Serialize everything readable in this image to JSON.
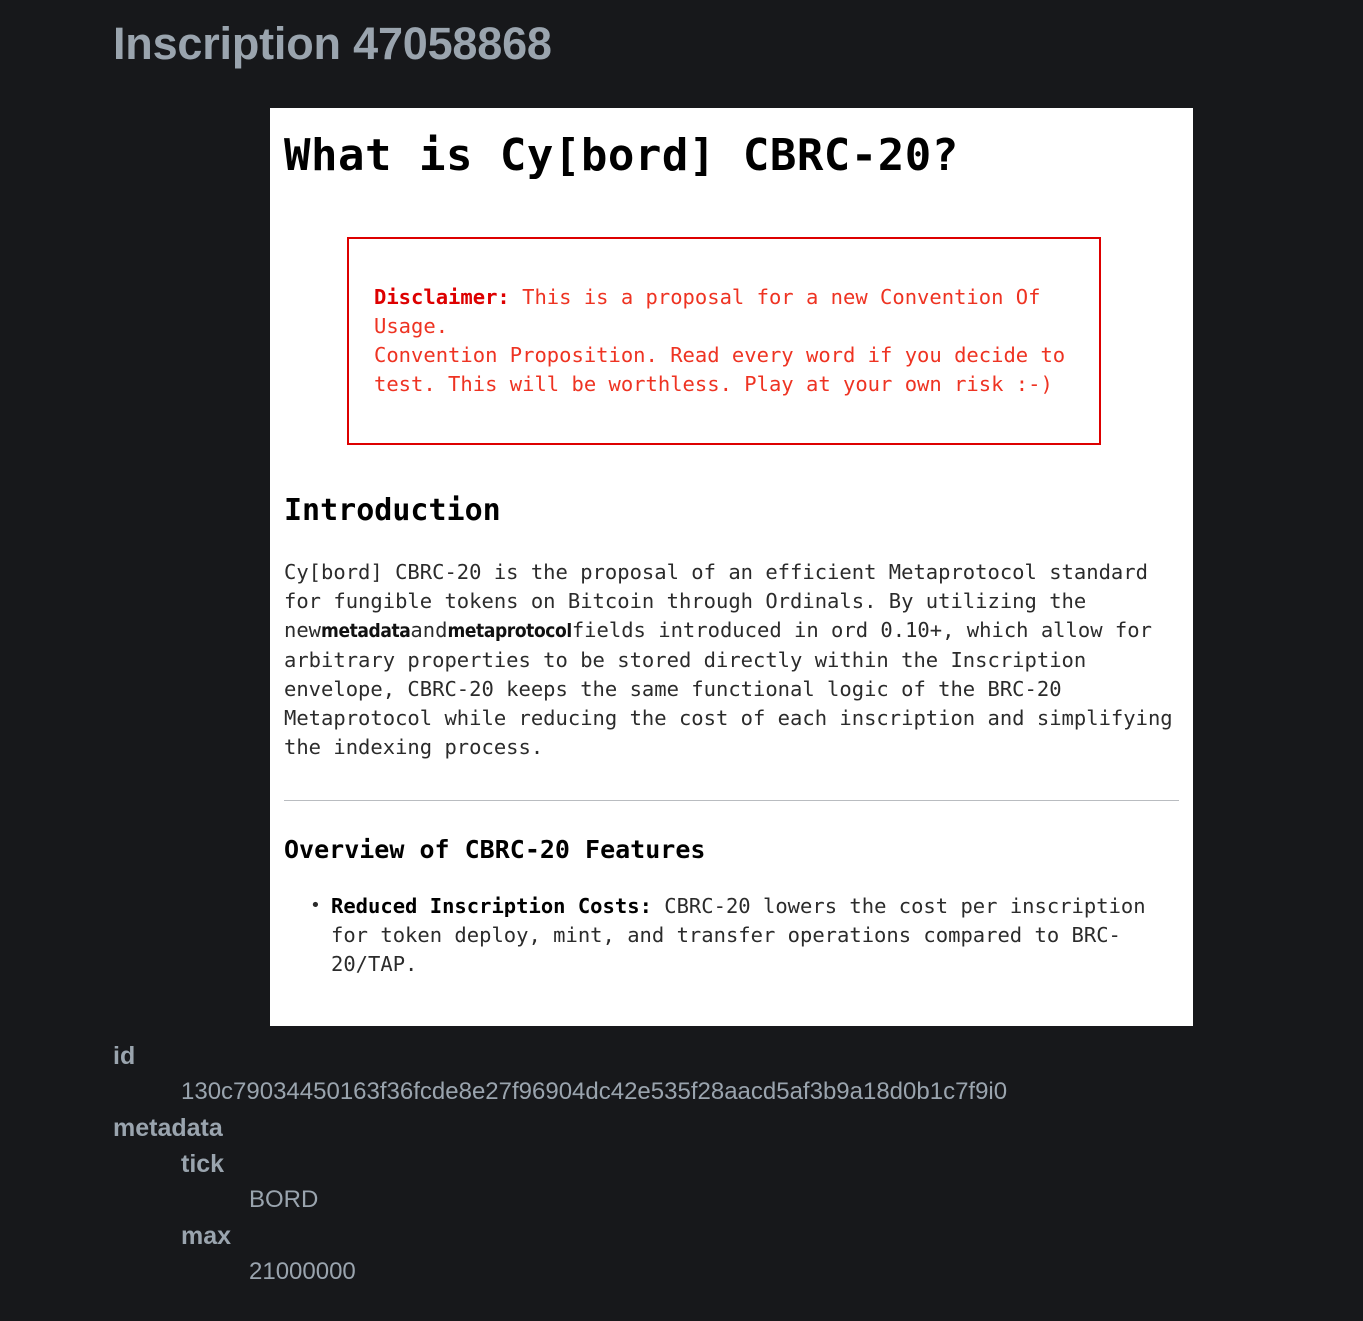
{
  "page": {
    "title": "Inscription 47058868",
    "background_color": "#17181b",
    "text_color": "#9aa4ae"
  },
  "preview": {
    "heading": "What is Cy[bord] CBRC-20?",
    "disclaimer": {
      "label": "Disclaimer",
      "separator": ": ",
      "border_color": "#dd0000",
      "text_color": "#ee3322",
      "line1": "This is a proposal for a new Convention Of Usage.",
      "line2": "Convention Proposition. Read every word if you decide to test. This will be worthless. Play at your own risk :-)"
    },
    "introduction": {
      "heading": "Introduction",
      "para_part1": "Cy[bord] CBRC-20 is the proposal of an efficient Metaprotocol standard for fungible tokens on Bitcoin through Ordinals. By utilizing the new",
      "code1": "metadata",
      "para_part2": "and",
      "code2": "metaprotocol",
      "para_part3": "fields introduced in ord 0.10+, which allow for arbitrary properties to be stored directly within the Inscription envelope, CBRC-20 keeps the same functional logic of the BRC-20 Metaprotocol while reducing the cost of each inscription and simplifying the indexing process."
    },
    "overview": {
      "heading": "Overview of CBRC-20 Features",
      "items": [
        {
          "term": "Reduced Inscription Costs",
          "separator": ": ",
          "text": "CBRC-20 lowers the cost per inscription for token deploy, mint, and transfer operations compared to BRC-20/TAP."
        }
      ]
    }
  },
  "metadata_tree": {
    "id_key": "id",
    "id_value": "130c79034450163f36fcde8e27f96904dc42e535f28aacd5af3b9a18d0b1c7f9i0",
    "metadata_key": "metadata",
    "fields": [
      {
        "key": "tick",
        "value": "BORD"
      },
      {
        "key": "max",
        "value": "21000000"
      }
    ]
  }
}
